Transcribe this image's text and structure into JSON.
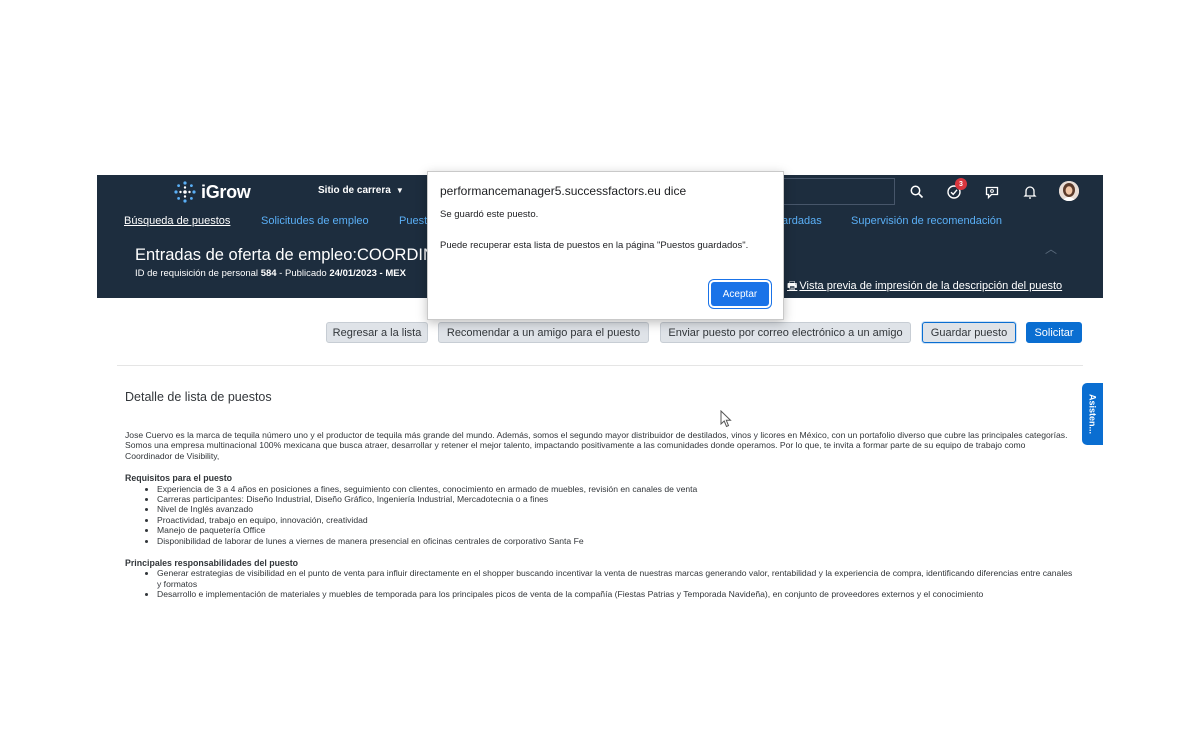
{
  "topbar": {
    "brand": "iGrow",
    "career_site": "Sitio de carrera",
    "todo_badge": "3"
  },
  "nav": {
    "items": [
      "Búsqueda de puestos",
      "Solicitudes de empleo",
      "Puest",
      "ardadas",
      "Supervisión de recomendación"
    ]
  },
  "header": {
    "title": "Entradas de oferta de empleo:COORDINA",
    "sub_prefix": "ID de requisición de personal ",
    "req_id": "584",
    "sub_mid": " - Publicado ",
    "date": "24/01/2023",
    "sub_suffix": " - MEX",
    "print_link": "Vista previa de impresión de la descripción del puesto"
  },
  "actions": {
    "back": "Regresar a la lista",
    "recommend": "Recomendar a un amigo para el puesto",
    "email": "Enviar puesto por correo electrónico a un amigo",
    "save": "Guardar puesto",
    "apply": "Solicitar"
  },
  "content": {
    "section_title": "Detalle de lista de puestos",
    "intro1": "Jose Cuervo es la marca de tequila número uno y el productor de tequila más grande del mundo. Además, somos el segundo mayor distribuidor de destilados, vinos y licores en México, con un portafolio diverso que cubre las principales categorías.",
    "intro2": "Somos una empresa multinacional 100% mexicana que busca atraer, desarrollar y retener el mejor talento, impactando positivamente a las comunidades donde operamos. Por lo que, te invita a formar parte de su equipo de trabajo como Coordinador de Visibility,",
    "req_heading": "Requisitos para el puesto",
    "requirements": [
      "Experiencia de 3 a 4 años en posiciones a fines, seguimiento con clientes, conocimiento en armado de muebles, revisión en canales de venta",
      "Carreras participantes: Diseño Industrial, Diseño Gráfico, Ingeniería Industrial, Mercadotecnia o a fines",
      "Nivel de Inglés avanzado",
      "Proactividad, trabajo en equipo, innovación, creatividad",
      "Manejo de paquetería Office",
      "Disponibilidad de laborar de lunes a viernes de manera presencial en oficinas centrales de corporativo Santa Fe"
    ],
    "resp_heading": "Principales responsabilidades del puesto",
    "responsibilities": [
      "Generar estrategias de visibilidad en el punto de venta para influir directamente en el shopper buscando incentivar la venta de nuestras marcas generando valor, rentabilidad y la experiencia de compra, identificando diferencias entre canales y formatos",
      "Desarrollo e implementación de materiales y muebles de temporada para los principales picos de venta de la compañía (Fiestas Patrias y Temporada Navideña), en conjunto de proveedores externos y el conocimiento"
    ]
  },
  "side_tab": "Asisten...",
  "dialog": {
    "title": "performancemanager5.successfactors.eu dice",
    "message1": "Se guardó este puesto.",
    "message2": "Puede recuperar esta lista de puestos en la página \"Puestos guardados\".",
    "ok": "Aceptar"
  },
  "colors": {
    "shell": "#1d2d3e",
    "link": "#5aaff6",
    "primary": "#0a6ed1",
    "dialog_button": "#1a73e8"
  }
}
